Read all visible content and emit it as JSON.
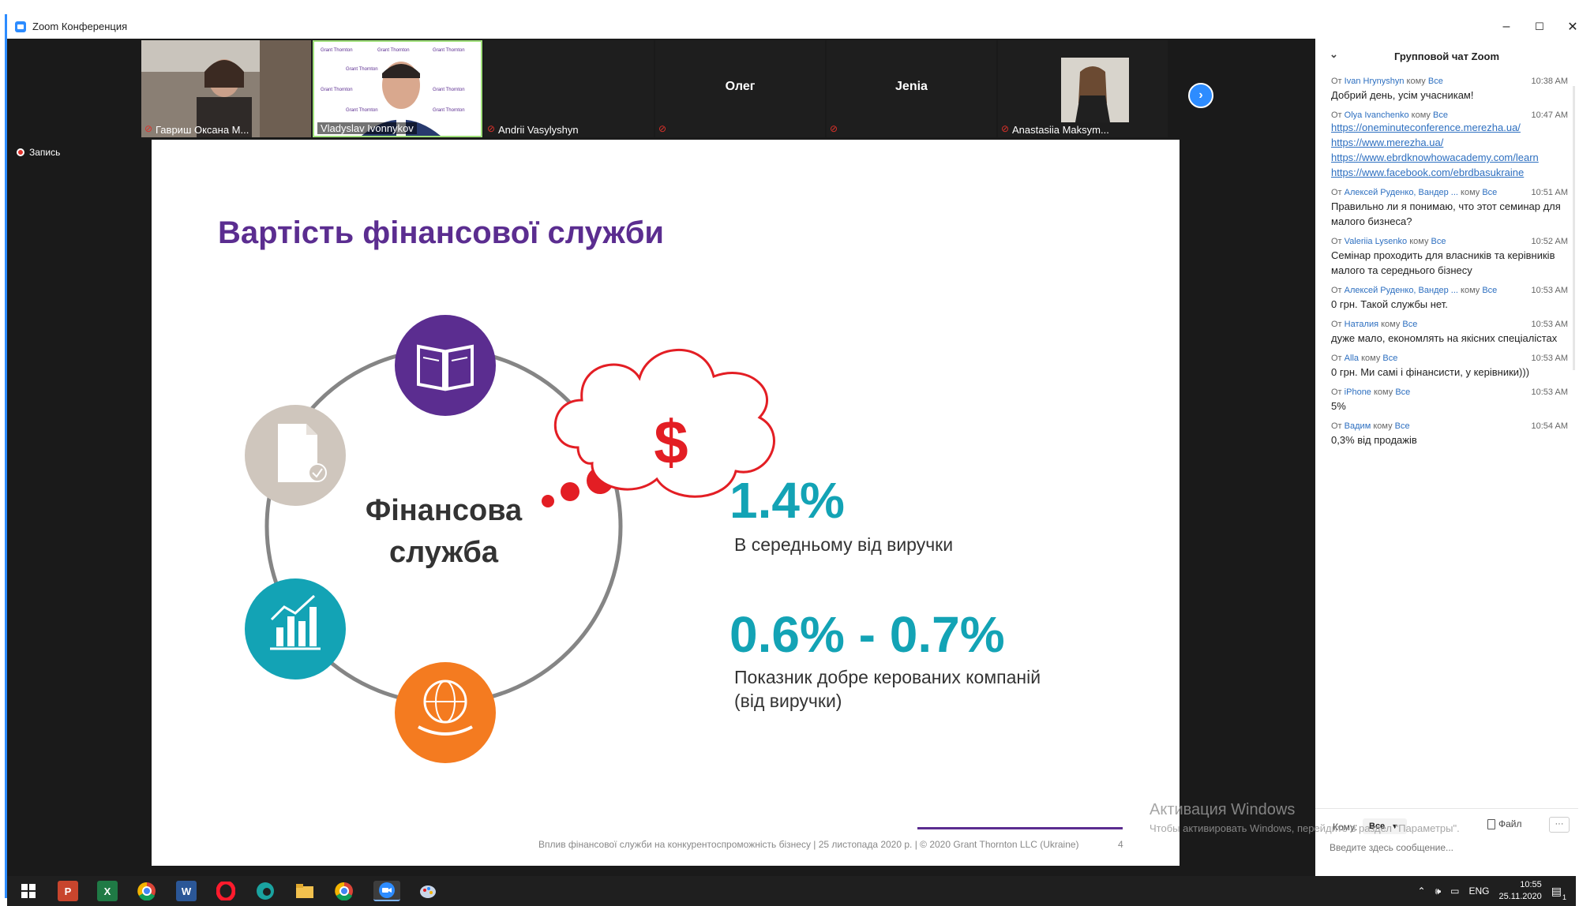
{
  "window": {
    "title": "Zoom Конференция",
    "minimize": "–",
    "maximize": "☐",
    "close": "✕"
  },
  "participants": [
    {
      "name": "Гавриш Оксана М...",
      "muted": true,
      "video": true
    },
    {
      "name": "Vladyslav Ivonnykov",
      "muted": false,
      "video": true,
      "active_speaker": true
    },
    {
      "name": "Andrii Vasylyshyn",
      "muted": true,
      "video": false
    },
    {
      "name": "Олег",
      "muted": true,
      "video": false
    },
    {
      "name": "Jenia",
      "muted": true,
      "video": false
    },
    {
      "name": "Anastasiia Maksym...",
      "muted": true,
      "video": true
    }
  ],
  "recording": {
    "label": "Запись"
  },
  "slide": {
    "title": "Вартість фінансової служби",
    "center_label_1": "Фінансова",
    "center_label_2": "служба",
    "cloud_symbol": "$",
    "stat1_value": "1.4%",
    "stat1_label": "В середньому від виручки",
    "stat2_value": "0.6% - 0.7%",
    "stat2_label_1": "Показник добре керованих компаній",
    "stat2_label_2": "(від виручки)",
    "footer": "Вплив фінансової служби на конкурентоспроможність бізнесу | 25 листопада 2020 р. | © 2020 Grant Thornton LLC (Ukraine)",
    "page_number": "4",
    "colors": {
      "purple": "#5b2d90",
      "teal": "#13a3b5",
      "orange": "#f47b20",
      "red": "#e31e24",
      "beige": "#cfc6bd"
    },
    "icons": [
      "book-icon",
      "document-icon",
      "bar-chart-icon",
      "globe-hand-icon",
      "dollar-cloud-icon"
    ]
  },
  "chat": {
    "title": "Групповой чат Zoom",
    "messages": [
      {
        "from": "Ivan Hrynyshyn",
        "to": "Все",
        "time": "10:38 AM",
        "text": "Добрий день, усім учасникам!"
      },
      {
        "from": "Olya Ivanchenko",
        "to": "Все",
        "time": "10:47 AM",
        "links": [
          "https://oneminuteconference.merezha.ua/",
          "https://www.merezha.ua/",
          "https://www.ebrdknowhowacademy.com/learn",
          "https://www.facebook.com/ebrdbasukraine"
        ]
      },
      {
        "from": "Алексей Руденко, Вандер ...",
        "to": "Все",
        "time": "10:51 AM",
        "text": "Правильно ли я понимаю, что этот семинар для малого бизнеса?"
      },
      {
        "from": "Valeriia Lysenko",
        "to": "Все",
        "time": "10:52 AM",
        "text": "Семінар проходить для власників та керівників малого та середнього бізнесу"
      },
      {
        "from": "Алексей Руденко, Вандер ...",
        "to": "Все",
        "time": "10:53 AM",
        "text": "0 грн. Такой службы нет."
      },
      {
        "from": "Наталия",
        "to": "Все",
        "time": "10:53 AM",
        "text": "дуже мало, економлять на якісних спеціалістах"
      },
      {
        "from": "Alla",
        "to": "Все",
        "time": "10:53 AM",
        "text": "0 грн. Ми самі і фінансисти, у керівники)))"
      },
      {
        "from": "iPhone",
        "to": "Все",
        "time": "10:53 AM",
        "text": "5%"
      },
      {
        "from": "Вадим",
        "to": "Все",
        "time": "10:54 AM",
        "text": "0,3% від продажів"
      }
    ],
    "from_prefix": "От",
    "to_prefix": "кому",
    "to_label": "Кому:",
    "to_value": "Все",
    "file_label": "Файл",
    "more_label": "···",
    "input_placeholder": "Введите здесь сообщение..."
  },
  "activation": {
    "title": "Активация Windows",
    "subtitle": "Чтобы активировать Windows, перейдите в раздел \"Параметры\"."
  },
  "taskbar": {
    "apps": [
      "windows-start",
      "powerpoint",
      "excel",
      "chrome",
      "word",
      "opera",
      "edge",
      "file-explorer",
      "chrome",
      "zoom",
      "paint"
    ],
    "language": "ENG",
    "time": "10:55",
    "date": "25.11.2020",
    "notifications": "1"
  }
}
